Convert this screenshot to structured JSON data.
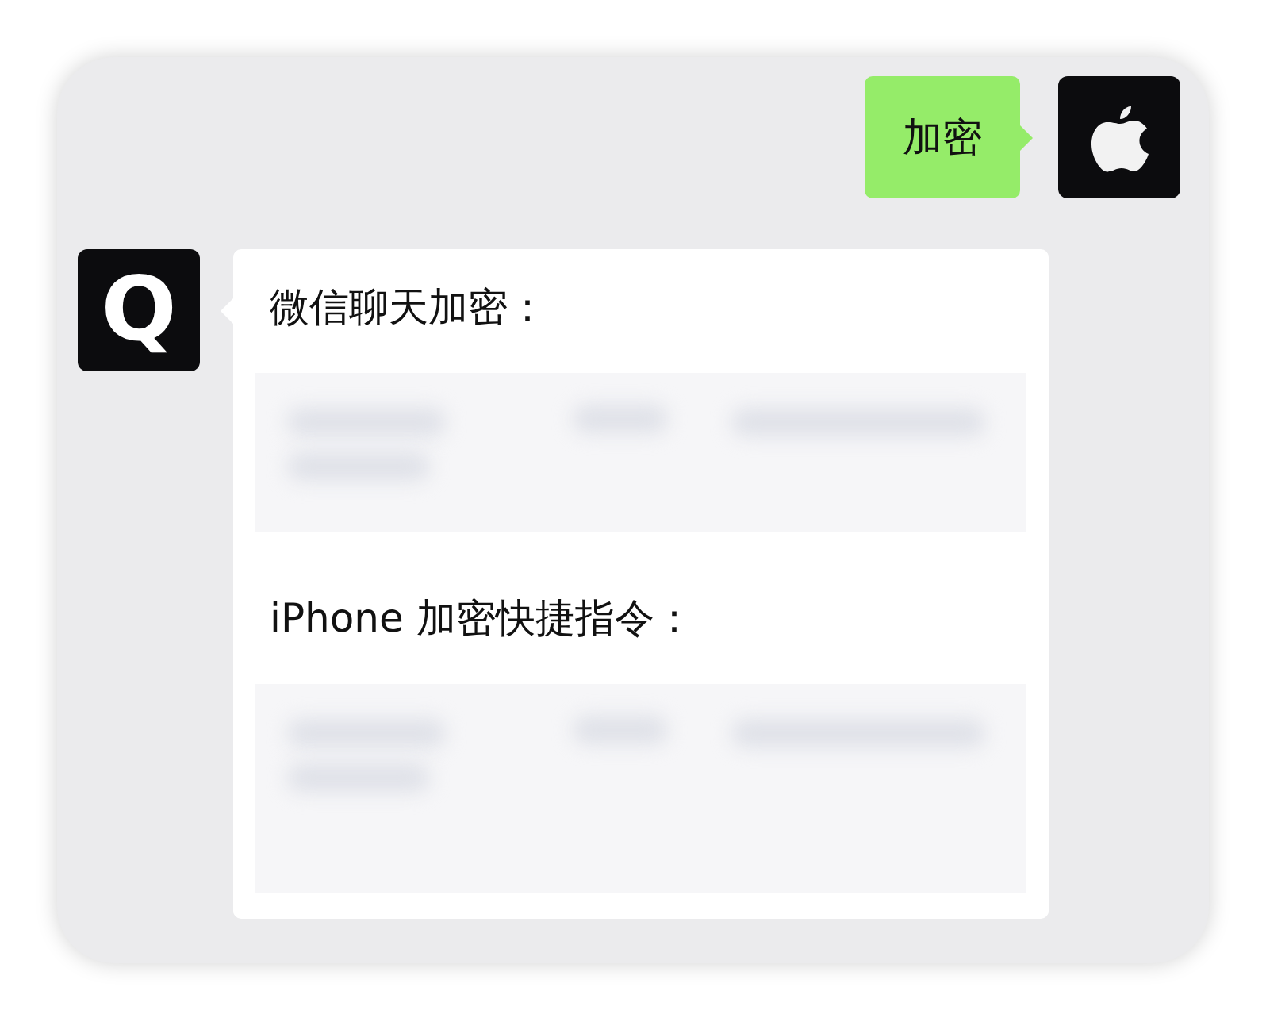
{
  "messages": [
    {
      "outgoing": true,
      "avatar": {
        "kind": "apple"
      },
      "kind": "text",
      "text": "加密"
    },
    {
      "outgoing": false,
      "avatar": {
        "kind": "letter",
        "text": "Q"
      },
      "kind": "sections",
      "sections": [
        {
          "heading": "微信聊天加密："
        },
        {
          "heading": "iPhone 加密快捷指令："
        }
      ]
    }
  ]
}
